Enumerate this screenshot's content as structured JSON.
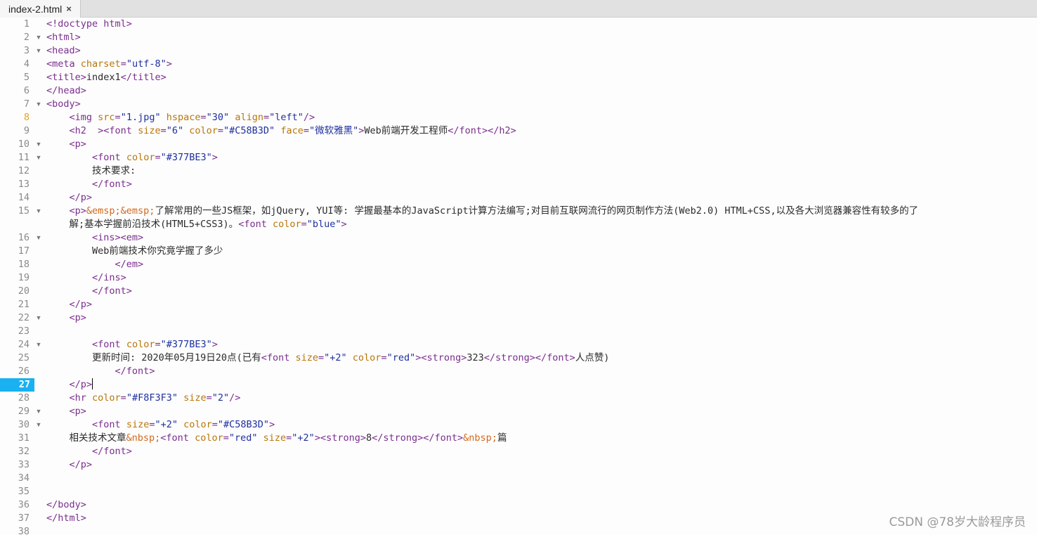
{
  "tab": {
    "title": "index-2.html",
    "close": "×"
  },
  "active_line": "27",
  "lines": [
    {
      "n": "1",
      "fold": false,
      "indent": "",
      "tokens": [
        [
          "t",
          "<!doctype html>"
        ]
      ]
    },
    {
      "n": "2",
      "fold": true,
      "indent": "",
      "tokens": [
        [
          "t",
          "<html>"
        ]
      ]
    },
    {
      "n": "3",
      "fold": true,
      "indent": "",
      "tokens": [
        [
          "t",
          "<head>"
        ]
      ]
    },
    {
      "n": "4",
      "fold": false,
      "indent": "",
      "tokens": [
        [
          "t",
          "<meta "
        ],
        [
          "a",
          "charset"
        ],
        [
          "t",
          "="
        ],
        [
          "v",
          "\"utf-8\""
        ],
        [
          "t",
          ">"
        ]
      ]
    },
    {
      "n": "5",
      "fold": false,
      "indent": "",
      "tokens": [
        [
          "t",
          "<title>"
        ],
        [
          "x",
          "index1"
        ],
        [
          "t",
          "</title>"
        ]
      ]
    },
    {
      "n": "6",
      "fold": false,
      "indent": "",
      "tokens": [
        [
          "t",
          "</head>"
        ]
      ]
    },
    {
      "n": "7",
      "fold": true,
      "indent": "",
      "tokens": [
        [
          "t",
          "<body>"
        ]
      ]
    },
    {
      "n": "8",
      "fold": false,
      "mod": true,
      "indent": "    ",
      "tokens": [
        [
          "t",
          "<img "
        ],
        [
          "a",
          "src"
        ],
        [
          "t",
          "="
        ],
        [
          "v",
          "\"1.jpg\""
        ],
        [
          "x",
          " "
        ],
        [
          "a",
          "hspace"
        ],
        [
          "t",
          "="
        ],
        [
          "v",
          "\"30\""
        ],
        [
          "x",
          " "
        ],
        [
          "a",
          "align"
        ],
        [
          "t",
          "="
        ],
        [
          "v",
          "\"left\""
        ],
        [
          "t",
          "/>"
        ]
      ]
    },
    {
      "n": "9",
      "fold": false,
      "indent": "    ",
      "tokens": [
        [
          "t",
          "<h2  ><font "
        ],
        [
          "a",
          "size"
        ],
        [
          "t",
          "="
        ],
        [
          "v",
          "\"6\""
        ],
        [
          "x",
          " "
        ],
        [
          "a",
          "color"
        ],
        [
          "t",
          "="
        ],
        [
          "v",
          "\"#C58B3D\""
        ],
        [
          "x",
          " "
        ],
        [
          "a",
          "face"
        ],
        [
          "t",
          "="
        ],
        [
          "v",
          "\"微软雅黑\""
        ],
        [
          "t",
          ">"
        ],
        [
          "x",
          "Web前端开发工程师"
        ],
        [
          "t",
          "</font></h2>"
        ]
      ]
    },
    {
      "n": "10",
      "fold": true,
      "indent": "    ",
      "tokens": [
        [
          "t",
          "<p>"
        ]
      ]
    },
    {
      "n": "11",
      "fold": true,
      "indent": "        ",
      "tokens": [
        [
          "t",
          "<font "
        ],
        [
          "a",
          "color"
        ],
        [
          "t",
          "="
        ],
        [
          "v",
          "\"#377BE3\""
        ],
        [
          "t",
          ">"
        ]
      ]
    },
    {
      "n": "12",
      "fold": false,
      "indent": "        ",
      "tokens": [
        [
          "x",
          "技术要求:"
        ]
      ]
    },
    {
      "n": "13",
      "fold": false,
      "indent": "        ",
      "tokens": [
        [
          "t",
          "</font>"
        ]
      ]
    },
    {
      "n": "14",
      "fold": false,
      "indent": "    ",
      "tokens": [
        [
          "t",
          "</p>"
        ]
      ]
    },
    {
      "n": "15",
      "fold": true,
      "indent": "    ",
      "tokens": [
        [
          "t",
          "<p>"
        ],
        [
          "e",
          "&emsp;&emsp;"
        ],
        [
          "x",
          "了解常用的一些JS框架，如jQuery, YUI等: 学握最基本的JavaScript计算方法编写;对目前互联网流行的网页制作方法(Web2.0) HTML+CSS,以及各大浏览器兼容性有较多的了"
        ]
      ]
    },
    {
      "n": "",
      "fold": false,
      "indent": "    ",
      "tokens": [
        [
          "x",
          "解;基本学握前沿技术(HTML5+CSS3)。"
        ],
        [
          "t",
          "<font "
        ],
        [
          "a",
          "color"
        ],
        [
          "t",
          "="
        ],
        [
          "v",
          "\"blue\""
        ],
        [
          "t",
          ">"
        ]
      ]
    },
    {
      "n": "16",
      "fold": true,
      "indent": "        ",
      "tokens": [
        [
          "t",
          "<ins><em>"
        ]
      ]
    },
    {
      "n": "17",
      "fold": false,
      "indent": "        ",
      "tokens": [
        [
          "x",
          "Web前端技术你究竟学握了多少"
        ]
      ]
    },
    {
      "n": "18",
      "fold": false,
      "indent": "            ",
      "tokens": [
        [
          "t",
          "</em>"
        ]
      ]
    },
    {
      "n": "19",
      "fold": false,
      "indent": "        ",
      "tokens": [
        [
          "t",
          "</ins>"
        ]
      ]
    },
    {
      "n": "20",
      "fold": false,
      "indent": "        ",
      "tokens": [
        [
          "t",
          "</font>"
        ]
      ]
    },
    {
      "n": "21",
      "fold": false,
      "indent": "    ",
      "tokens": [
        [
          "t",
          "</p>"
        ]
      ]
    },
    {
      "n": "22",
      "fold": true,
      "indent": "    ",
      "tokens": [
        [
          "t",
          "<p>"
        ]
      ]
    },
    {
      "n": "23",
      "fold": false,
      "indent": "",
      "tokens": []
    },
    {
      "n": "24",
      "fold": true,
      "indent": "        ",
      "tokens": [
        [
          "t",
          "<font "
        ],
        [
          "a",
          "color"
        ],
        [
          "t",
          "="
        ],
        [
          "v",
          "\"#377BE3\""
        ],
        [
          "t",
          ">"
        ]
      ]
    },
    {
      "n": "25",
      "fold": false,
      "indent": "        ",
      "tokens": [
        [
          "x",
          "更新时间: 2020年05月19日20点(已有"
        ],
        [
          "t",
          "<font "
        ],
        [
          "a",
          "size"
        ],
        [
          "t",
          "="
        ],
        [
          "v",
          "\"+2\""
        ],
        [
          "x",
          " "
        ],
        [
          "a",
          "color"
        ],
        [
          "t",
          "="
        ],
        [
          "v",
          "\"red\""
        ],
        [
          "t",
          "><strong>"
        ],
        [
          "x",
          "323"
        ],
        [
          "t",
          "</strong></font>"
        ],
        [
          "x",
          "人点赞)"
        ]
      ]
    },
    {
      "n": "26",
      "fold": false,
      "indent": "            ",
      "tokens": [
        [
          "t",
          "</font>"
        ]
      ]
    },
    {
      "n": "27",
      "fold": false,
      "active": true,
      "indent": "    ",
      "tokens": [
        [
          "t",
          "</p>"
        ]
      ]
    },
    {
      "n": "28",
      "fold": false,
      "indent": "    ",
      "tokens": [
        [
          "t",
          "<hr "
        ],
        [
          "a",
          "color"
        ],
        [
          "t",
          "="
        ],
        [
          "v",
          "\"#F8F3F3\""
        ],
        [
          "x",
          " "
        ],
        [
          "a",
          "size"
        ],
        [
          "t",
          "="
        ],
        [
          "v",
          "\"2\""
        ],
        [
          "t",
          "/>"
        ]
      ]
    },
    {
      "n": "29",
      "fold": true,
      "indent": "    ",
      "tokens": [
        [
          "t",
          "<p>"
        ]
      ]
    },
    {
      "n": "30",
      "fold": true,
      "indent": "        ",
      "tokens": [
        [
          "t",
          "<font "
        ],
        [
          "a",
          "size"
        ],
        [
          "t",
          "="
        ],
        [
          "v",
          "\"+2\""
        ],
        [
          "x",
          " "
        ],
        [
          "a",
          "color"
        ],
        [
          "t",
          "="
        ],
        [
          "v",
          "\"#C58B3D\""
        ],
        [
          "t",
          ">"
        ]
      ]
    },
    {
      "n": "31",
      "fold": false,
      "indent": "    ",
      "tokens": [
        [
          "x",
          "相关技术文章"
        ],
        [
          "e",
          "&nbsp;"
        ],
        [
          "t",
          "<font "
        ],
        [
          "a",
          "color"
        ],
        [
          "t",
          "="
        ],
        [
          "v",
          "\"red\""
        ],
        [
          "x",
          " "
        ],
        [
          "a",
          "size"
        ],
        [
          "t",
          "="
        ],
        [
          "v",
          "\"+2\""
        ],
        [
          "t",
          "><strong>"
        ],
        [
          "x",
          "8"
        ],
        [
          "t",
          "</strong></font>"
        ],
        [
          "e",
          "&nbsp;"
        ],
        [
          "x",
          "篇"
        ]
      ]
    },
    {
      "n": "32",
      "fold": false,
      "indent": "        ",
      "tokens": [
        [
          "t",
          "</font>"
        ]
      ]
    },
    {
      "n": "33",
      "fold": false,
      "indent": "    ",
      "tokens": [
        [
          "t",
          "</p>"
        ]
      ]
    },
    {
      "n": "34",
      "fold": false,
      "indent": "",
      "tokens": []
    },
    {
      "n": "35",
      "fold": false,
      "indent": "",
      "tokens": []
    },
    {
      "n": "36",
      "fold": false,
      "indent": "",
      "tokens": [
        [
          "t",
          "</body>"
        ]
      ]
    },
    {
      "n": "37",
      "fold": false,
      "indent": "",
      "tokens": [
        [
          "t",
          "</html>"
        ]
      ]
    },
    {
      "n": "38",
      "fold": false,
      "indent": "",
      "tokens": []
    }
  ],
  "watermark": "CSDN @78岁大龄程序员",
  "colors": {
    "tag": "#7a2e8e",
    "attr": "#b8760a",
    "value": "#1e2f9e",
    "entity": "#d2691e",
    "active_line_bg": "#1ab1f0"
  },
  "icons": {
    "fold": "triangle-down-icon",
    "close": "close-icon"
  }
}
